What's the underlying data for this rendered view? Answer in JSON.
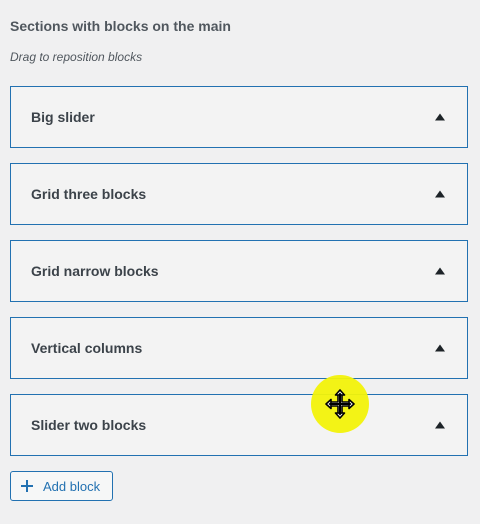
{
  "panel": {
    "title": "Sections with blocks on the main",
    "description": "Drag to reposition blocks"
  },
  "blocks": [
    {
      "label": "Big slider"
    },
    {
      "label": "Grid three blocks"
    },
    {
      "label": "Grid narrow blocks"
    },
    {
      "label": "Vertical columns"
    },
    {
      "label": "Slider two blocks"
    }
  ],
  "add_button": {
    "label": "Add block",
    "icon": "plus-icon"
  },
  "cursor": {
    "icon": "move-cursor-icon",
    "highlight_color": "#f2f20a"
  },
  "colors": {
    "accent": "#2271b1",
    "background": "#f0f0f1",
    "block_background": "#f3f3f3"
  }
}
